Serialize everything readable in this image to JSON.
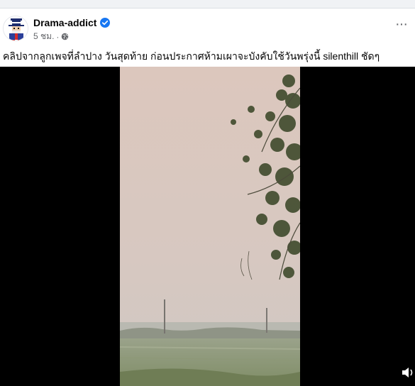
{
  "post": {
    "author": "Drama-addict",
    "time": "5 ชม.",
    "separator": "·",
    "caption": "คลิปจากลูกเพจที่ลำปาง วันสุดท้าย ก่อนประกาศห้ามเผาจะบังคับใช้วันพรุ่งนี้  silenthill ชัดๆ",
    "more_label": "···"
  },
  "icons": {
    "verified": "verified-badge-icon",
    "audience": "globe-icon",
    "more": "more-options-icon",
    "volume": "volume-icon"
  },
  "colors": {
    "brand_blue": "#1877f2",
    "text_primary": "#050505",
    "text_secondary": "#65676b",
    "video_background": "#000000"
  }
}
